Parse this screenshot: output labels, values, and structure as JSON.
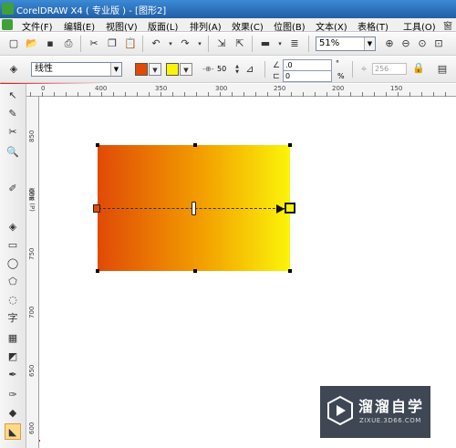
{
  "window": {
    "title": "CorelDRAW X4 ( 专业版 ) - [图形2]"
  },
  "menu": [
    {
      "label": "文件(F)"
    },
    {
      "label": "编辑(E)"
    },
    {
      "label": "视图(V)"
    },
    {
      "label": "版面(L)"
    },
    {
      "label": "排列(A)"
    },
    {
      "label": "效果(C)"
    },
    {
      "label": "位图(B)"
    },
    {
      "label": "文本(X)"
    },
    {
      "label": "表格(T)"
    },
    {
      "label": "工具(O)"
    }
  ],
  "menu_overflow": "窗",
  "standard_toolbar": {
    "zoom_value": "51%"
  },
  "property_bar": {
    "fill_type": "线性",
    "start_color": "#e04a07",
    "end_color": "#fbf40a",
    "midpoint": "50",
    "angle": ".0",
    "edge_pad": "0",
    "edge_pad_unit": "%",
    "angle_unit": "°",
    "steps": "256"
  },
  "rulers": {
    "horizontal_labels": [
      "0",
      "400",
      "350",
      "300",
      "250",
      "200",
      "150"
    ],
    "vertical_labels": [
      "850",
      "800",
      "750",
      "700",
      "650",
      "600"
    ],
    "vertical_unit": "毫米 (P)"
  },
  "toolbox": [
    {
      "icon": "pick-tool-icon",
      "glyph": "↖"
    },
    {
      "icon": "shape-tool-icon",
      "glyph": "✎"
    },
    {
      "icon": "crop-tool-icon",
      "glyph": "✂"
    },
    {
      "icon": "zoom-tool-icon",
      "glyph": "🔍"
    },
    {
      "icon": "freehand-tool-icon",
      "glyph": "✐"
    },
    {
      "icon": "smart-fill-icon",
      "glyph": "◈"
    },
    {
      "icon": "rectangle-tool-icon",
      "glyph": "▭"
    },
    {
      "icon": "ellipse-tool-icon",
      "glyph": "◯"
    },
    {
      "icon": "polygon-tool-icon",
      "glyph": "⬠"
    },
    {
      "icon": "basic-shapes-icon",
      "glyph": "◌"
    },
    {
      "icon": "text-tool-icon",
      "glyph": "字"
    },
    {
      "icon": "table-tool-icon",
      "glyph": "▦"
    },
    {
      "icon": "interactive-blend-icon",
      "glyph": "◩"
    },
    {
      "icon": "eyedropper-icon",
      "glyph": "✒"
    },
    {
      "icon": "outline-pen-icon",
      "glyph": "✑"
    },
    {
      "icon": "fill-tool-icon",
      "glyph": "◆"
    },
    {
      "icon": "interactive-fill-icon",
      "glyph": "◣"
    }
  ],
  "watermark": {
    "title": "溜溜自学",
    "url": "ZIXUE.3D66.COM"
  }
}
